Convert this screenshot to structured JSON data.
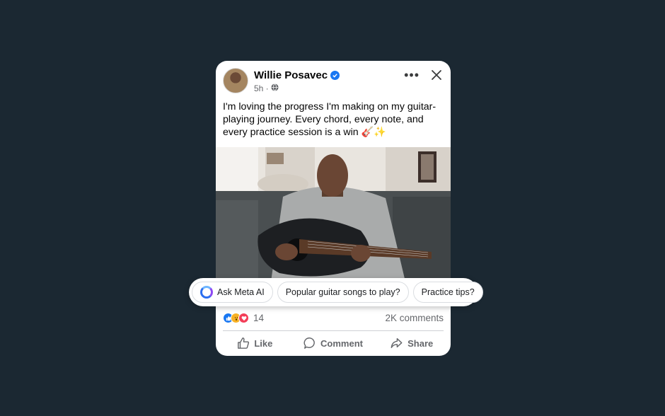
{
  "post": {
    "author": "Willie Posavec",
    "time": "5h ·",
    "text": "I'm loving the progress I'm making on my guitar-playing journey. Every chord, every note, and every practice session is a win 🎸✨",
    "reaction_count": "14",
    "comments": "2K comments"
  },
  "icons": {
    "verified": "verified-badge-icon",
    "privacy": "globe-icon",
    "more": "more-horizontal-icon",
    "close": "close-icon",
    "reactions": [
      "like-reaction-icon",
      "wow-reaction-icon",
      "love-reaction-icon"
    ],
    "like": "thumbs-up-icon",
    "comment": "comment-bubble-icon",
    "share": "share-arrow-icon",
    "meta_ai": "meta-ai-ring-icon"
  },
  "actions": {
    "like": "Like",
    "comment": "Comment",
    "share": "Share"
  },
  "suggestions": {
    "ask": "Ask Meta AI",
    "songs": "Popular guitar songs to play?",
    "tips": "Practice tips?"
  },
  "colors": {
    "background": "#1b2832",
    "card": "#ffffff",
    "accent": "#1877f2",
    "secondary_text": "#65676b"
  }
}
